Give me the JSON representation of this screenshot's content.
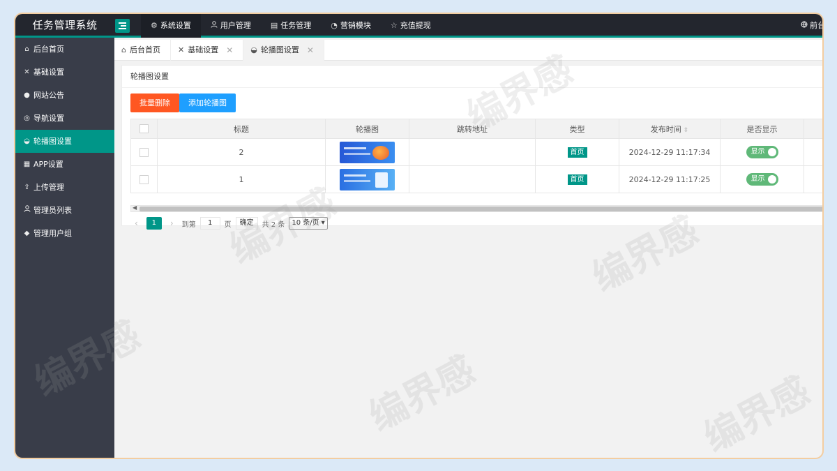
{
  "header": {
    "brand": "任务管理系统",
    "nav": [
      {
        "label": "系统设置",
        "icon": "gear-icon",
        "glyph": "⚙",
        "active": true
      },
      {
        "label": "用户管理",
        "icon": "user-icon",
        "glyph": "👤",
        "active": false
      },
      {
        "label": "任务管理",
        "icon": "clipboard-icon",
        "glyph": "▤",
        "active": false
      },
      {
        "label": "营销模块",
        "icon": "dashboard-icon",
        "glyph": "◔",
        "active": false
      },
      {
        "label": "充值提现",
        "icon": "star-icon",
        "glyph": "☆",
        "active": false
      }
    ],
    "front_link": "前台"
  },
  "sidebar": {
    "items": [
      {
        "label": "后台首页",
        "icon": "home-icon",
        "glyph": "⌂",
        "active": false
      },
      {
        "label": "基础设置",
        "icon": "tools-icon",
        "glyph": "✕",
        "active": false
      },
      {
        "label": "网站公告",
        "icon": "message-icon",
        "glyph": "●",
        "active": false
      },
      {
        "label": "导航设置",
        "icon": "compass-icon",
        "glyph": "◎",
        "active": false
      },
      {
        "label": "轮播图设置",
        "icon": "palette-icon",
        "glyph": "◒",
        "active": true
      },
      {
        "label": "APP设置",
        "icon": "app-icon",
        "glyph": "▦",
        "active": false
      },
      {
        "label": "上传管理",
        "icon": "upload-icon",
        "glyph": "⇪",
        "active": false
      },
      {
        "label": "管理员列表",
        "icon": "admin-icon",
        "glyph": "👤",
        "active": false
      },
      {
        "label": "管理用户组",
        "icon": "group-icon",
        "glyph": "◆",
        "active": false
      }
    ]
  },
  "tabs": [
    {
      "label": "后台首页",
      "icon": "home-icon",
      "glyph": "⌂",
      "closable": false
    },
    {
      "label": "基础设置",
      "icon": "tools-icon",
      "glyph": "✕",
      "closable": true
    },
    {
      "label": "轮播图设置",
      "icon": "palette-icon",
      "glyph": "◒",
      "closable": true
    }
  ],
  "card": {
    "title": "轮播图设置",
    "batch_delete": "批量删除",
    "add_banner": "添加轮播图"
  },
  "table": {
    "columns": [
      "标题",
      "轮播图",
      "跳转地址",
      "类型",
      "发布时间",
      "是否显示"
    ],
    "rows": [
      {
        "title": "2",
        "url": "",
        "type": "首页",
        "time": "2024-12-29 11:17:34",
        "show": "显示"
      },
      {
        "title": "1",
        "url": "",
        "type": "首页",
        "time": "2024-12-29 11:17:25",
        "show": "显示"
      }
    ]
  },
  "pager": {
    "current": "1",
    "goto_label": "到第",
    "page_input": "1",
    "page_unit": "页",
    "confirm": "确定",
    "total": "共 2 条",
    "page_size": "10 条/页"
  },
  "watermark": "编界感",
  "colors": {
    "accent": "#009688",
    "danger": "#ff5722",
    "info": "#1e9fff",
    "switch_on": "#5fb878"
  }
}
